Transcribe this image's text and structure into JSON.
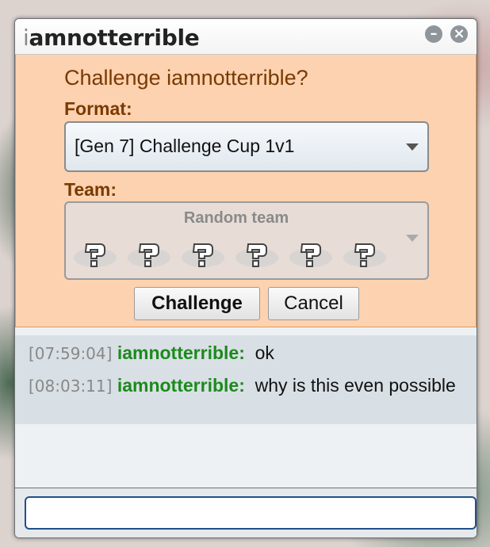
{
  "window": {
    "title_first_char": "i",
    "title_rest": "amnotterrible",
    "min_icon": "minimize-icon",
    "close_icon": "close-icon"
  },
  "challenge": {
    "heading": "Challenge iamnotterrible?",
    "format_label": "Format:",
    "format_value": "[Gen 7] Challenge Cup 1v1",
    "team_label": "Team:",
    "team_value": "Random team",
    "team_icons": [
      "unknown-pokemon-icon",
      "unknown-pokemon-icon",
      "unknown-pokemon-icon",
      "unknown-pokemon-icon",
      "unknown-pokemon-icon",
      "unknown-pokemon-icon"
    ],
    "challenge_button": "Challenge",
    "cancel_button": "Cancel"
  },
  "chat": {
    "messages": [
      {
        "time": "[07:59:04]",
        "user": "iamnotterrible:",
        "text": "ok"
      },
      {
        "time": "[08:03:11]",
        "user": "iamnotterrible:",
        "text": "why is this even possible"
      }
    ],
    "input_value": ""
  },
  "colors": {
    "challenge_bg": "#fcd2b1",
    "challenge_text": "#7a3a00",
    "username": "#1c8a1c",
    "input_border": "#1f4f8a"
  }
}
